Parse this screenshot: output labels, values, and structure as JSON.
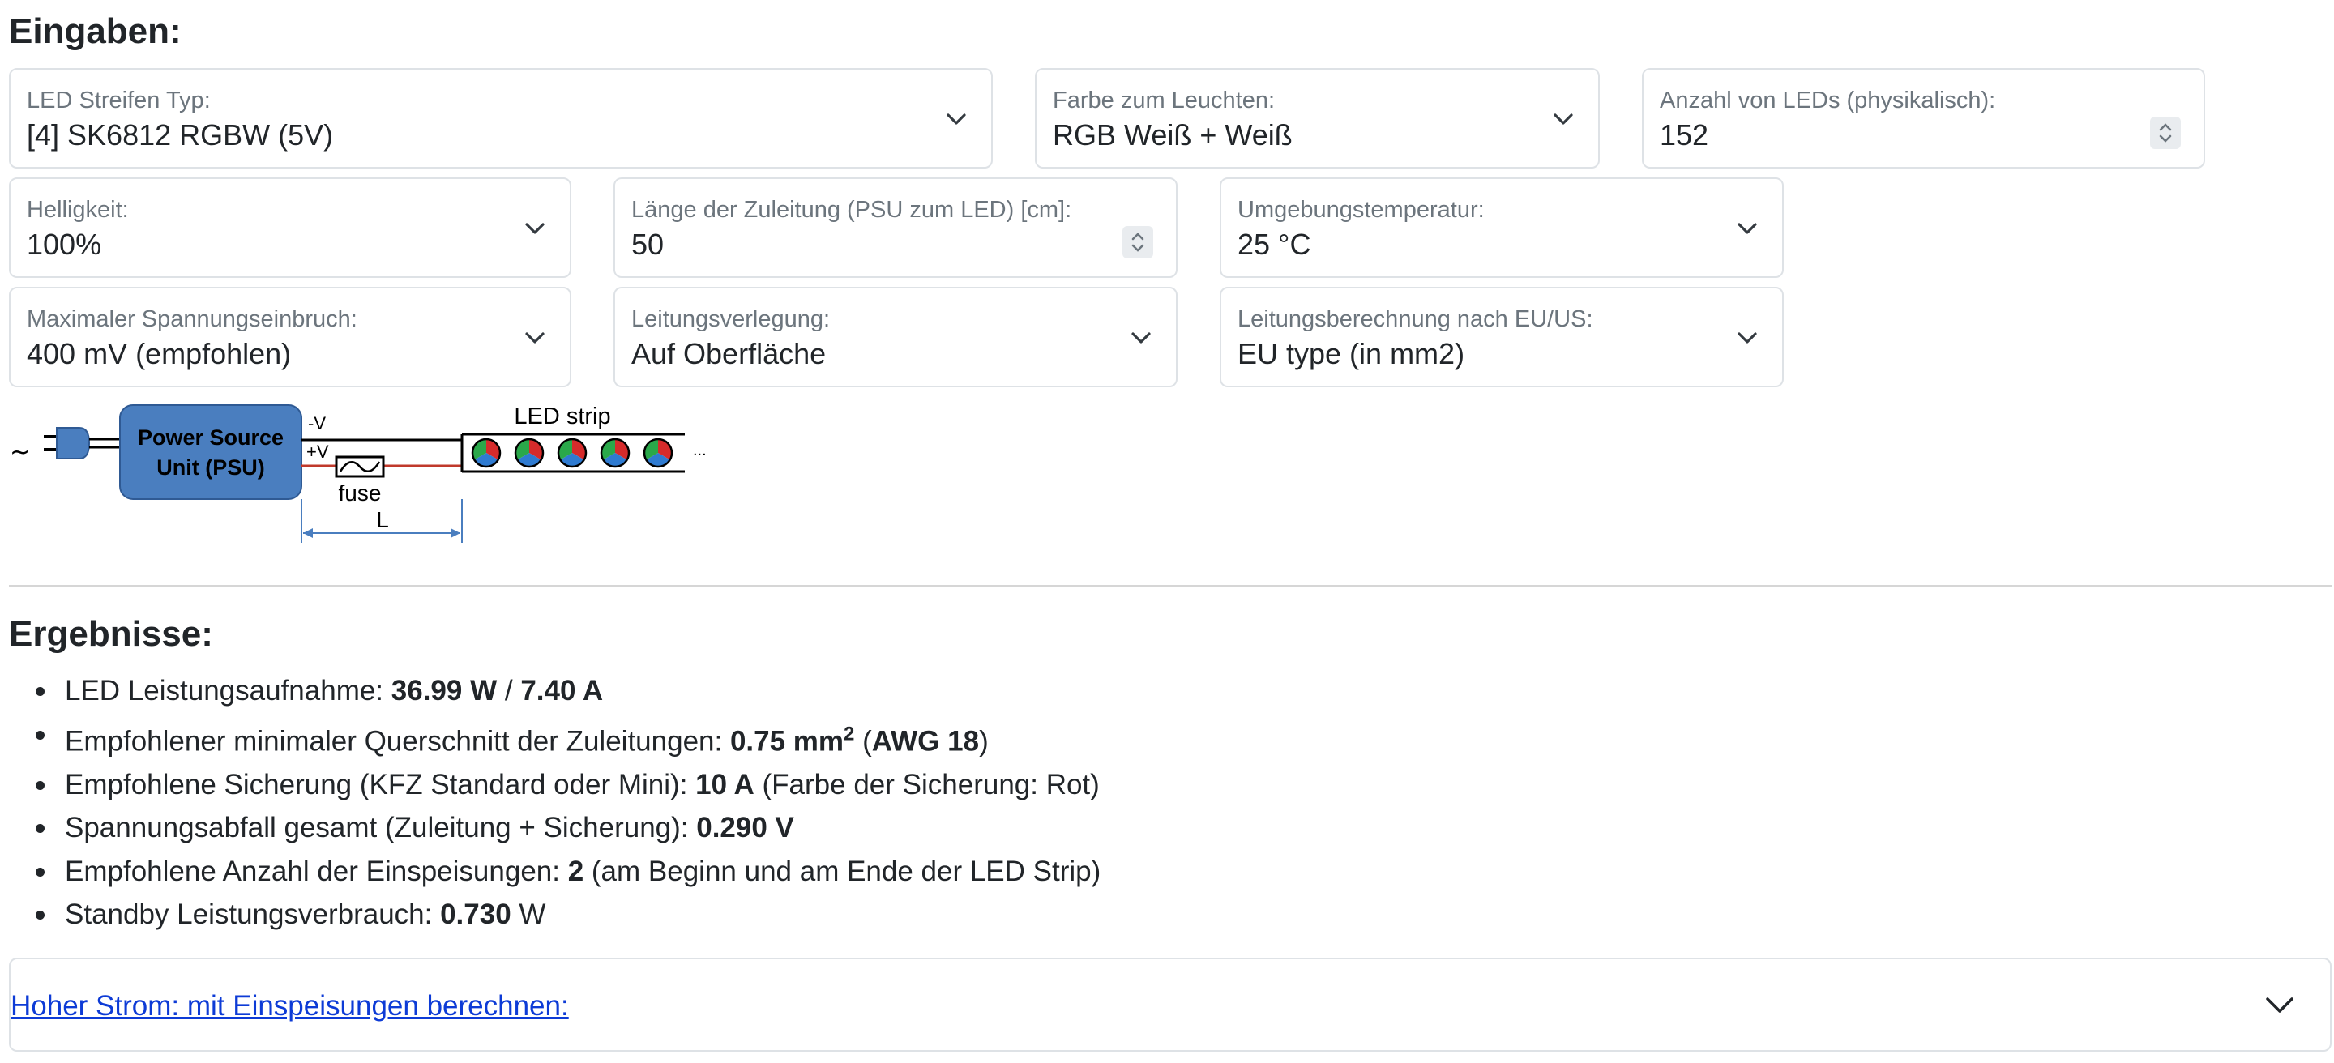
{
  "inputs": {
    "heading": "Eingaben:",
    "led_type": {
      "label": "LED Streifen Typ:",
      "value": "[4] SK6812 RGBW (5V)"
    },
    "color": {
      "label": "Farbe zum Leuchten:",
      "value": "RGB Weiß + Weiß"
    },
    "led_count": {
      "label": "Anzahl von LEDs (physikalisch):",
      "value": "152"
    },
    "brightness": {
      "label": "Helligkeit:",
      "value": "100%"
    },
    "lead_length": {
      "label": "Länge der Zuleitung (PSU zum LED) [cm]:",
      "value": "50"
    },
    "ambient_temp": {
      "label": "Umgebungstemperatur:",
      "value": "25 °C"
    },
    "max_voltage_drop": {
      "label": "Maximaler Spannungseinbruch:",
      "value": "400 mV (empfohlen)"
    },
    "cable_routing": {
      "label": "Leitungsverlegung:",
      "value": "Auf Oberfläche"
    },
    "cable_calc": {
      "label": "Leitungsberechnung nach EU/US:",
      "value": "EU type (in mm2)"
    }
  },
  "diagram": {
    "tilde": "~",
    "psu_line1": "Power Source",
    "psu_line2": "Unit (PSU)",
    "minus_v": "-V",
    "plus_v": "+V",
    "fuse": "fuse",
    "strip": "LED strip",
    "length": "L",
    "ellipsis": "...",
    "led_count": 5
  },
  "results": {
    "heading": "Ergebnisse:",
    "power": {
      "label": "LED Leistungsaufnahme: ",
      "watts": "36.99 W",
      "sep": " / ",
      "amps": "7.40 A"
    },
    "cross_section": {
      "label": "Empfohlener minimaler Querschnitt der Zuleitungen: ",
      "value": "0.75 mm",
      "sup": "2",
      "open": " (",
      "awg": "AWG 18",
      "close": ")"
    },
    "fuse": {
      "label": "Empfohlene Sicherung (KFZ Standard oder Mini): ",
      "value": "10 A",
      "note": " (Farbe der Sicherung: Rot)"
    },
    "voltage_drop": {
      "label": "Spannungsabfall gesamt (Zuleitung + Sicherung): ",
      "value": "0.290 V"
    },
    "feeds": {
      "label": "Empfohlene Anzahl der Einspeisungen: ",
      "value": "2",
      "note": " (am Beginn und am Ende der LED Strip)"
    },
    "standby": {
      "label": "Standby Leistungsverbrauch: ",
      "value": "0.730",
      "unit": " W"
    }
  },
  "accordion": {
    "label": "Hoher Strom: mit Einspeisungen berechnen:"
  },
  "colors": {
    "link": "#0d3bd6",
    "psu_fill": "#4a7ebf",
    "psu_stroke": "#2f5a94",
    "dimension": "#4a7ebf",
    "plus_wire": "#c0392b"
  },
  "icons": {
    "select": "chevron-down-icon",
    "number": "spinner-icon",
    "accordion": "chevron-down-icon"
  }
}
